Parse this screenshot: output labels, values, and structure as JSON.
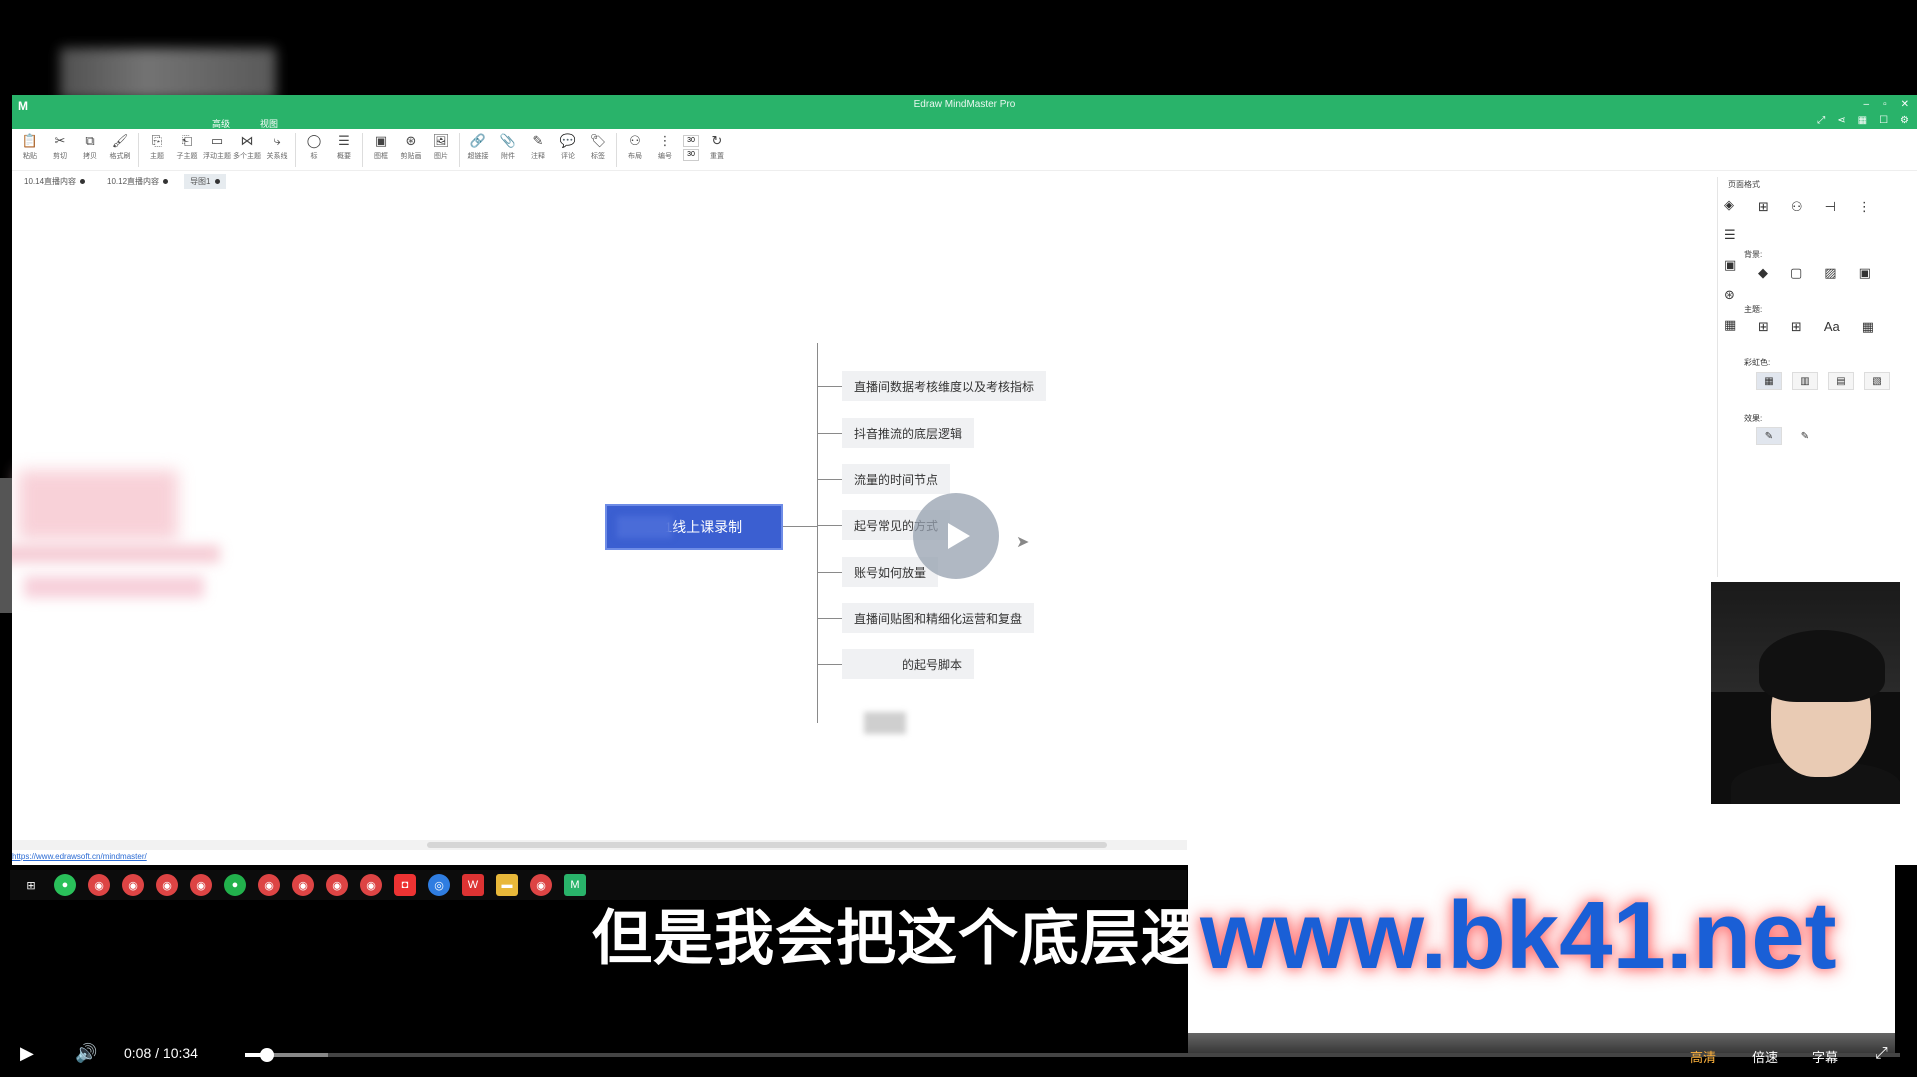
{
  "app": {
    "logo": "M",
    "title": "Edraw MindMaster Pro",
    "menus": [
      "高级",
      "视图"
    ],
    "window_buttons": [
      "–",
      "▫",
      "✕"
    ],
    "action_icons": [
      "⤢",
      "⋖",
      "▦",
      "☐",
      "⚙"
    ]
  },
  "ribbon": [
    {
      "icon": "📋",
      "label": "粘贴"
    },
    {
      "icon": "✂",
      "label": "剪切"
    },
    {
      "icon": "⧉",
      "label": "拷贝"
    },
    {
      "icon": "🖌",
      "label": "格式刷"
    },
    {
      "icon": "⎘",
      "label": "主题"
    },
    {
      "icon": "⎗",
      "label": "子主题"
    },
    {
      "icon": "▭",
      "label": "浮动主题"
    },
    {
      "icon": "⋈",
      "label": "多个主题"
    },
    {
      "icon": "⤷",
      "label": "关系线"
    },
    {
      "icon": "◯",
      "label": "标"
    },
    {
      "icon": "☰",
      "label": "概要"
    },
    {
      "icon": "▣",
      "label": "图框"
    },
    {
      "icon": "⊛",
      "label": "剪贴画"
    },
    {
      "icon": "🖼",
      "label": "图片"
    },
    {
      "icon": "🔗",
      "label": "超链接"
    },
    {
      "icon": "📎",
      "label": "附件"
    },
    {
      "icon": "✎",
      "label": "注释"
    },
    {
      "icon": "💬",
      "label": "评论"
    },
    {
      "icon": "🏷",
      "label": "标签"
    },
    {
      "icon": "⚇",
      "label": "布局"
    },
    {
      "icon": "⋮",
      "label": "编号"
    },
    {
      "icon": "↻",
      "label": "重置"
    }
  ],
  "spin_values": [
    "30",
    "30"
  ],
  "tabs": [
    {
      "label": "10.14直播内容"
    },
    {
      "label": "10.12直播内容"
    },
    {
      "label": "导图1"
    }
  ],
  "mindmap": {
    "main_topic": "11.1线上课录制",
    "subtopics": [
      "直播间数据考核维度以及考核指标",
      "抖音推流的底层逻辑",
      "流量的时间节点",
      "起号常见的方式",
      "账号如何放量",
      "直播间贴图和精细化运营和复盘",
      "的起号脚本"
    ]
  },
  "panel": {
    "title": "页面格式",
    "sections": [
      "背景:",
      "主题:",
      "彩虹色:",
      "效果:"
    ]
  },
  "status_url": "https://www.edrawsoft.cn/mindmaster/",
  "subtitle": "但是我会把这个底层逻辑",
  "watermark": "www.bk41.net",
  "player": {
    "time_current": "0:08",
    "time_total": "10:34",
    "time_separator": "/",
    "progress": 0.013,
    "buffered": 0.05,
    "right_controls": [
      "高清",
      "倍速",
      "字幕"
    ]
  },
  "colors": {
    "titlebar": "#29b36a",
    "main_topic": "#3b5fd1",
    "subtopic_bg": "#f0f1f3",
    "watermark_text": "#1a5fd6"
  }
}
